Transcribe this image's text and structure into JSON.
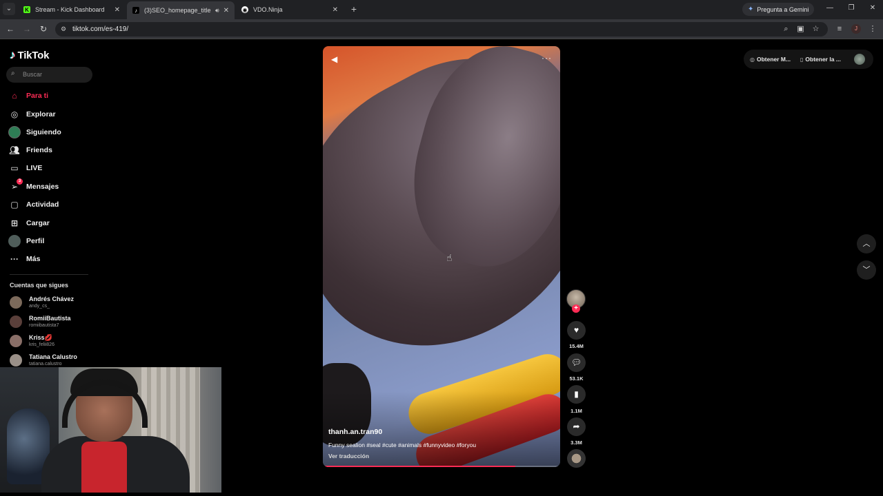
{
  "browser": {
    "tabs": [
      {
        "title": "Stream - Kick Dashboard",
        "favicon": "K",
        "favicon_color": "#53fc18",
        "active": false
      },
      {
        "title": "(3)SEO_homepage_title",
        "favicon": "♪",
        "favicon_color": "#ffffff",
        "active": true
      },
      {
        "title": "VDO.Ninja",
        "favicon": "◉",
        "favicon_color": "#ffffff",
        "active": false
      }
    ],
    "gemini_label": "Pregunta a Gemini",
    "url": "tiktok.com/es-419/",
    "profile_initial": "J"
  },
  "tiktok": {
    "logo_text": "TikTok",
    "search_placeholder": "Buscar",
    "nav": [
      {
        "label": "Para ti",
        "icon": "home-icon",
        "active": true
      },
      {
        "label": "Explorar",
        "icon": "compass-icon"
      },
      {
        "label": "Siguiendo",
        "icon": "following-avatar-icon"
      },
      {
        "label": "Friends",
        "icon": "friends-icon"
      },
      {
        "label": "LIVE",
        "icon": "live-icon"
      },
      {
        "label": "Mensajes",
        "icon": "messages-icon",
        "badge": "3"
      },
      {
        "label": "Actividad",
        "icon": "activity-icon"
      },
      {
        "label": "Cargar",
        "icon": "upload-icon"
      },
      {
        "label": "Perfil",
        "icon": "profile-avatar-icon"
      },
      {
        "label": "Más",
        "icon": "more-icon"
      }
    ],
    "following_title": "Cuentas que sigues",
    "following": [
      {
        "name": "Andrés Chávez",
        "handle": "andy_cs_"
      },
      {
        "name": "RomiiBautista",
        "handle": "romiibautista7"
      },
      {
        "name": "Kriss💋",
        "handle": "kris_felii826"
      },
      {
        "name": "Tatiana Calustro",
        "handle": "tatiana.calustro"
      }
    ],
    "video": {
      "author": "thanh.an.tran90",
      "caption": "Funny sealion #seal #cute #animals #funnyvideo #foryou",
      "translate": "Ver traducción",
      "progress": 0.81
    },
    "actions": {
      "likes": "15.4M",
      "comments": "53.1K",
      "saves": "1.1M",
      "shares": "3.3M"
    },
    "top_right": {
      "coins_label": "Obtener M...",
      "app_label": "Obtener la ..."
    },
    "accent_color": "#fe2c55"
  }
}
